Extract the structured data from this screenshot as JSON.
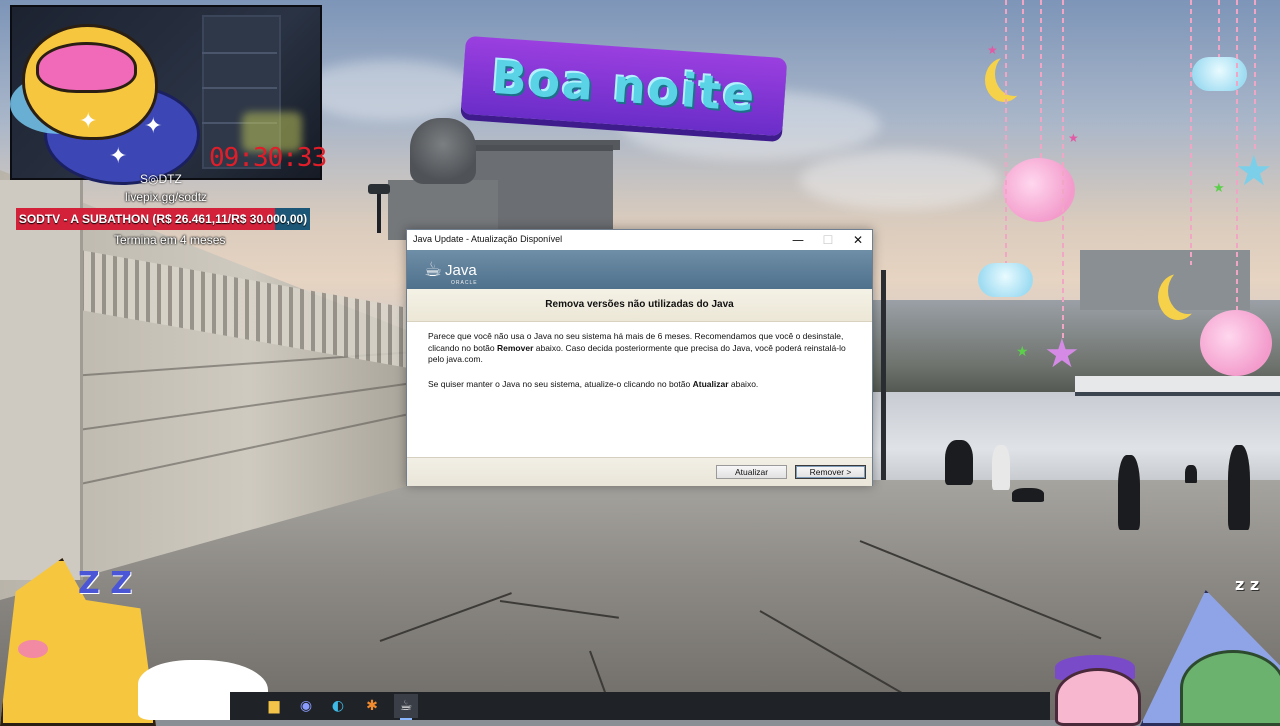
{
  "stream_overlay": {
    "timer": "09:30:33",
    "handle": "S◎DTZ",
    "livepix": "livepix.gg/sodtz",
    "goal_label": "SODTV - A SUBATHON (R$ 26.461,11/R$ 30.000,00)",
    "goal_progress_fraction": 0.882,
    "goal_subtext": "Termina em 4 meses",
    "banner_text": "Boa noite"
  },
  "dialog": {
    "window_title": "Java Update - Atualização Disponível",
    "logo_text": "Java",
    "logo_subtext": "ORACLE",
    "heading": "Remova versões não utilizadas do Java",
    "paragraph1_part1": "Parece que você não usa o Java no seu sistema há mais de 6 meses. Recomendamos que você o desinstale, clicando no botão ",
    "paragraph1_bold": "Remover",
    "paragraph1_part2": " abaixo. Caso decida posteriormente que precisa do Java, você poderá reinstalá-lo pelo java.com.",
    "paragraph2_part1": "Se quiser manter o Java no seu sistema, atualize-o clicando no botão ",
    "paragraph2_bold": "Atualizar",
    "paragraph2_part2": " abaixo.",
    "update_button": "Atualizar",
    "remove_button": "Remover >",
    "minimize_glyph": "—",
    "maximize_glyph": "☐",
    "close_glyph": "✕"
  },
  "taskbar": {
    "icons": [
      {
        "name": "file-explorer-icon",
        "glyph": "▆"
      },
      {
        "name": "discord-icon",
        "glyph": "◉"
      },
      {
        "name": "edge-icon",
        "glyph": "◐"
      },
      {
        "name": "tool-icon",
        "glyph": "✱"
      },
      {
        "name": "java-icon",
        "glyph": "☕"
      }
    ]
  },
  "decorations": {
    "zzz_left": "Z Z",
    "zzz_right": "z z",
    "bone": "🦴",
    "star": "★"
  },
  "colors": {
    "goal_fill": "#d3213a",
    "goal_track": "#1c5676",
    "timer": "#e01e2a",
    "java_banner": "#5b7c96"
  }
}
